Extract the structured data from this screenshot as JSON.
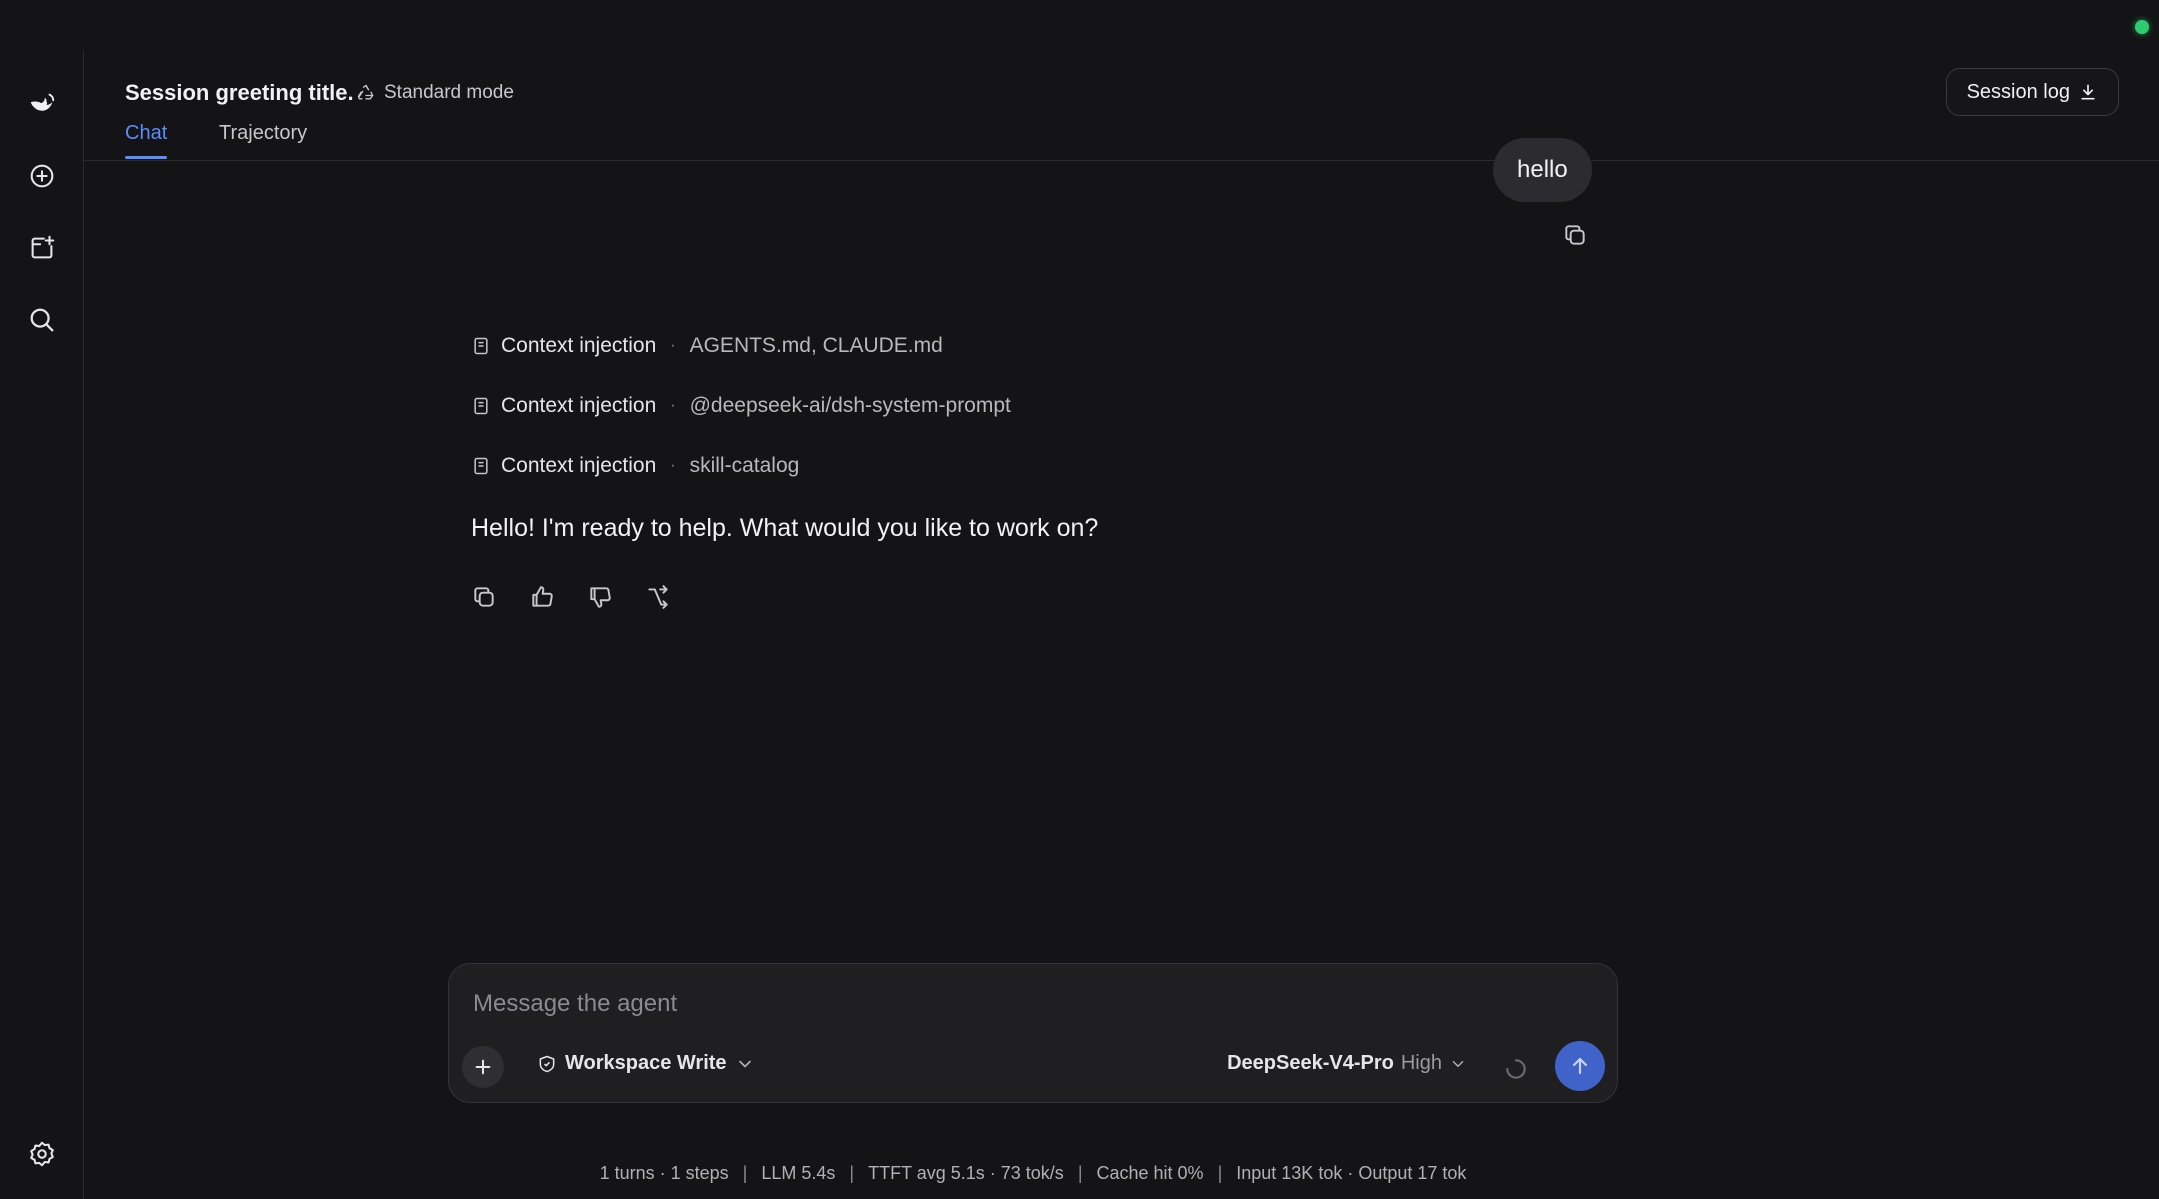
{
  "header": {
    "title": "Session greeting title.",
    "mode_label": "Standard mode",
    "session_log_label": "Session log",
    "tabs": [
      {
        "label": "Chat",
        "active": true
      },
      {
        "label": "Trajectory",
        "active": false
      }
    ]
  },
  "sidebar": {
    "items": [
      {
        "name": "deepseek-logo-icon"
      },
      {
        "name": "new-chat-icon"
      },
      {
        "name": "new-project-icon"
      },
      {
        "name": "search-icon"
      },
      {
        "name": "settings-icon"
      }
    ]
  },
  "conversation": {
    "user_message": "hello",
    "context_injections": [
      {
        "label": "Context injection",
        "value": "AGENTS.md, CLAUDE.md"
      },
      {
        "label": "Context injection",
        "value": "@deepseek-ai/dsh-system-prompt"
      },
      {
        "label": "Context injection",
        "value": "skill-catalog"
      }
    ],
    "assistant_message": "Hello! I'm ready to help. What would you like to work on?"
  },
  "composer": {
    "placeholder": "Message the agent",
    "value": "",
    "workspace_label": "Workspace Write",
    "model_name": "DeepSeek-V4-Pro",
    "model_level": "High"
  },
  "stats": {
    "turns": "1 turns · 1 steps",
    "llm": "LLM 5.4s",
    "ttft": "TTFT avg 5.1s · 73 tok/s",
    "cache": "Cache hit 0%",
    "tokens": "Input 13K tok · Output 17 tok"
  },
  "colors": {
    "accent": "#5b8cff",
    "send_button": "#3f63c9",
    "status_online": "#2ecc71",
    "background": "#141416"
  }
}
